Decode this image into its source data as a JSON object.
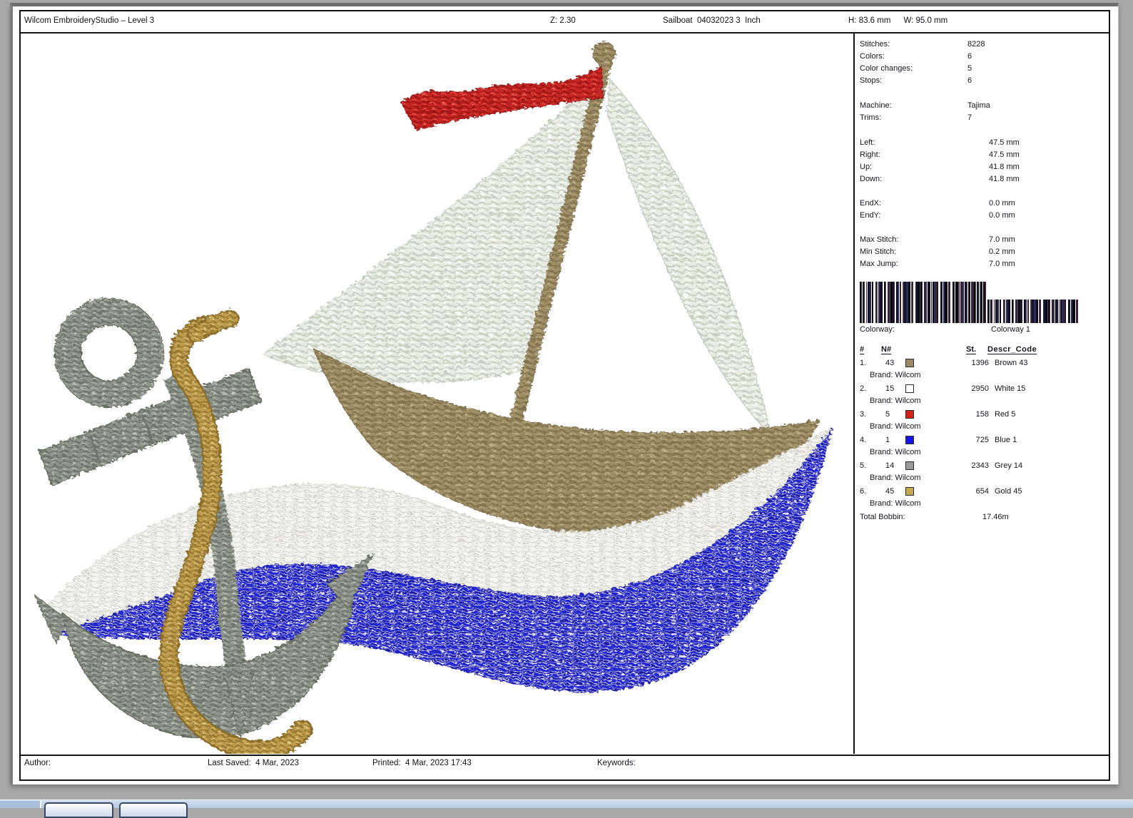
{
  "header": {
    "title": "Wilcom EmbroideryStudio – Level 3",
    "zoom": "Z: 2.30",
    "doc_name": "Sailboat  04032023 3  Inch",
    "size_h": "H: 83.6 mm",
    "size_w": "W: 95.0 mm"
  },
  "stats": {
    "stitches": {
      "label": "Stitches:",
      "value": "8228"
    },
    "colors": {
      "label": "Colors:",
      "value": "6"
    },
    "color_changes": {
      "label": "Color changes:",
      "value": "5"
    },
    "stops": {
      "label": "Stops:",
      "value": "6"
    },
    "machine": {
      "label": "Machine:",
      "value": "Tajima"
    },
    "trims": {
      "label": "Trims:",
      "value": "7"
    },
    "left": {
      "label": "Left:",
      "value": "47.5 mm"
    },
    "right": {
      "label": "Right:",
      "value": "47.5 mm"
    },
    "up": {
      "label": "Up:",
      "value": "41.8 mm"
    },
    "down": {
      "label": "Down:",
      "value": "41.8 mm"
    },
    "end_x": {
      "label": "EndX:",
      "value": "0.0 mm"
    },
    "end_y": {
      "label": "EndY:",
      "value": "0.0 mm"
    },
    "max_stitch": {
      "label": "Max Stitch:",
      "value": "7.0 mm"
    },
    "min_stitch": {
      "label": "Min Stitch:",
      "value": "0.2 mm"
    },
    "max_jump": {
      "label": "Max Jump:",
      "value": "7.0 mm"
    }
  },
  "colorway": {
    "label": "Colorway:",
    "value": "Colorway 1"
  },
  "thread_table": {
    "headers": {
      "num": "#",
      "n": "N#",
      "st": "St.",
      "descr": "Descr_Code"
    },
    "rows": [
      {
        "num": "1.",
        "n": "43",
        "swatch": "#9b8a65",
        "st": "1396",
        "descr": "Brown 43",
        "brand": "Brand: Wilcom"
      },
      {
        "num": "2.",
        "n": "15",
        "swatch": "#ffffff",
        "st": "2950",
        "descr": "White 15",
        "brand": "Brand: Wilcom"
      },
      {
        "num": "3.",
        "n": "5",
        "swatch": "#d42019",
        "st": "158",
        "descr": "Red 5",
        "brand": "Brand: Wilcom"
      },
      {
        "num": "4.",
        "n": "1",
        "swatch": "#1414e6",
        "st": "725",
        "descr": "Blue 1",
        "brand": "Brand: Wilcom"
      },
      {
        "num": "5.",
        "n": "14",
        "swatch": "#9a9a9a",
        "st": "2343",
        "descr": "Grey 14",
        "brand": "Brand: Wilcom"
      },
      {
        "num": "6.",
        "n": "45",
        "swatch": "#c8a850",
        "st": "654",
        "descr": "Gold 45",
        "brand": "Brand: Wilcom"
      }
    ],
    "total": {
      "label": "Total Bobbin:",
      "value": "17.46m"
    }
  },
  "footer": {
    "author": "Author:",
    "last_saved": "Last Saved:  4 Mar, 2023",
    "printed": "Printed:  4 Mar, 2023 17:43",
    "keywords": "Keywords:"
  },
  "design": {
    "colors": {
      "sail": "#e9ece3",
      "sail_stitch": "#c6cfc0",
      "tan": "#9e8e67",
      "tan_stitch": "#82734e",
      "red": "#c82723",
      "red_stitch": "#9c1815",
      "wave_white": "#f4f4f0",
      "wave_white_stitch": "#d7d7cf",
      "blue": "#2326cf",
      "blue_base": "#e2e2f2",
      "grey": "#8e948a",
      "grey_stitch": "#6d7369",
      "gold": "#bc9b4d",
      "gold_stitch": "#94762f"
    }
  }
}
